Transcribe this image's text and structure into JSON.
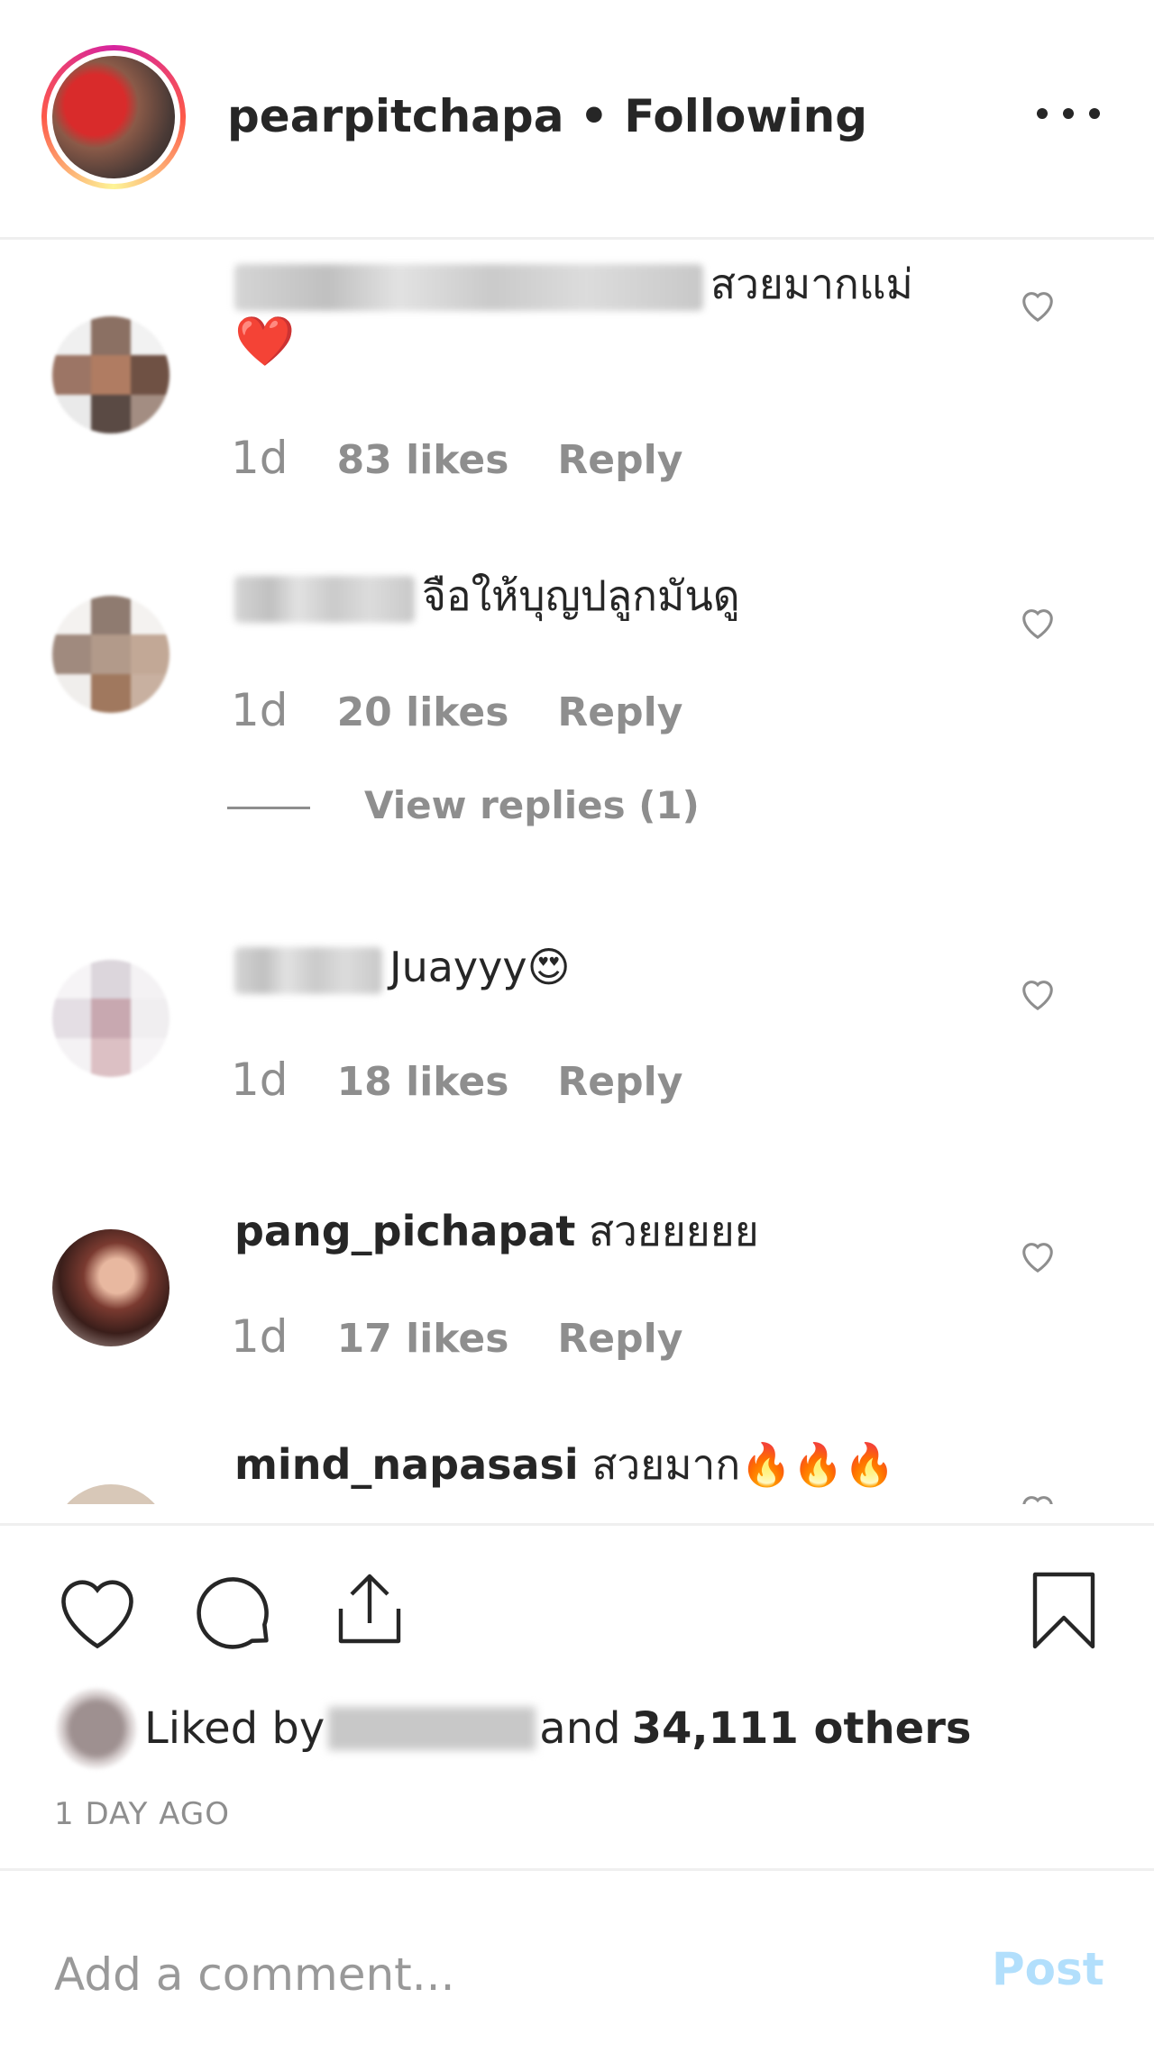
{
  "header": {
    "username": "pearpitchapa",
    "separator": " • ",
    "follow_status": "Following"
  },
  "comments": [
    {
      "username": "",
      "text": "สวยมากแม่",
      "emoji": "❤️",
      "age": "1d",
      "likes": "83 likes",
      "reply": "Reply"
    },
    {
      "username": "",
      "text": "จือให้บุญปลูกมันดู",
      "age": "1d",
      "likes": "20 likes",
      "reply": "Reply"
    },
    {
      "username": "",
      "text": "Juayyy😍",
      "age": "1d",
      "likes": "18 likes",
      "reply": "Reply"
    },
    {
      "username": "pang_pichapat",
      "text": "สวยยยยย",
      "age": "1d",
      "likes": "17 likes",
      "reply": "Reply"
    },
    {
      "username": "mind_napasasi",
      "text": "สวยมาก🔥🔥🔥"
    }
  ],
  "view_replies": "View replies (1)",
  "actions": {
    "icons": [
      "heart-icon",
      "comment-icon",
      "share-icon",
      "bookmark-icon"
    ]
  },
  "likes_summary": {
    "prefix": "Liked by",
    "middle": "and",
    "count": "34,111 others"
  },
  "timestamp": "1 DAY AGO",
  "add_comment": {
    "placeholder": "Add a comment...",
    "post_label": "Post"
  },
  "colors": {
    "text": "#262626",
    "secondary": "#8e8e8e",
    "post_disabled": "#b2dffc",
    "divider": "#efefef"
  }
}
